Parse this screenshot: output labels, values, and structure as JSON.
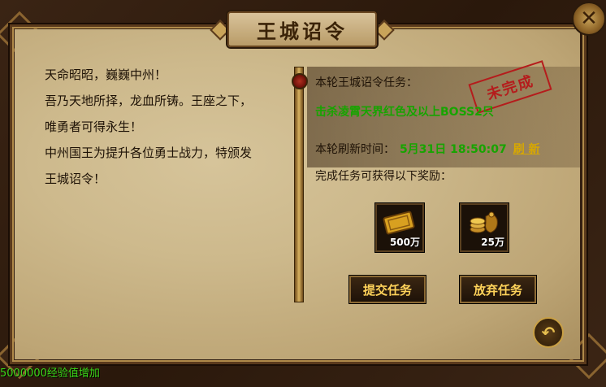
{
  "title": "王城诏令",
  "close_icon": "close-icon",
  "intro_lines": [
    "天命昭昭，巍巍中州！",
    "吾乃天地所择，龙血所铸。王座之下，",
    "唯勇者可得永生！",
    "中州国王为提升各位勇士战力，特颁发",
    "王城诏令！"
  ],
  "task": {
    "label": "本轮王城诏令任务：",
    "description": "击杀凌霄天界红色及以上BOSS2只",
    "stamp": "未完成"
  },
  "refresh": {
    "label": "本轮刷新时间：",
    "time": "5月31日 18:50:07",
    "link": "刷 新"
  },
  "reward_label": "完成任务可获得以下奖励：",
  "rewards": [
    {
      "icon": "exp-ticket-icon",
      "amount": "500万"
    },
    {
      "icon": "gold-coins-icon",
      "amount": "25万"
    }
  ],
  "buttons": {
    "submit": "提交任务",
    "abandon": "放弃任务"
  },
  "back_icon": "back-arrow-icon",
  "status_text": "5000000经验值增加",
  "colors": {
    "green_text": "#17a400",
    "link_yellow": "#d8a800",
    "stamp_red": "#b51c1c",
    "button_text": "#ffd35a",
    "status_green": "#3ad818"
  }
}
